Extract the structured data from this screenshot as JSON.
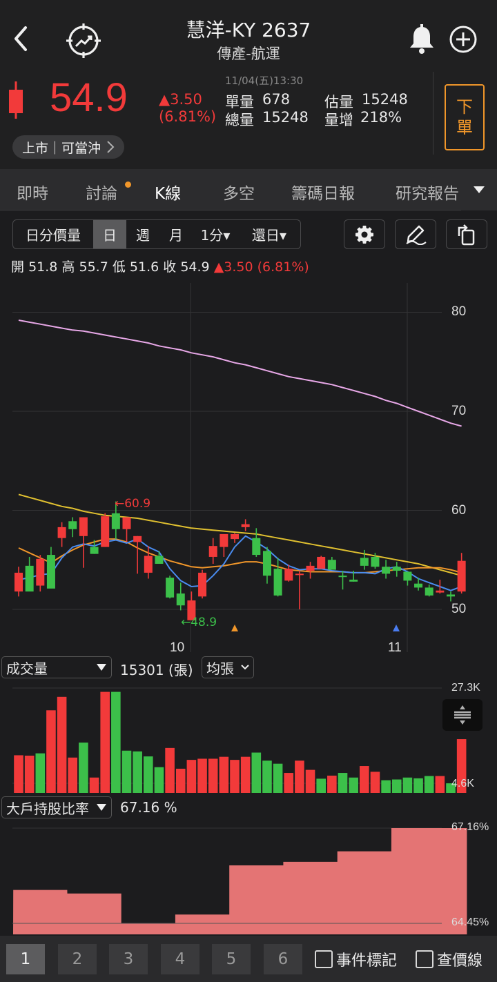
{
  "header": {
    "title": "慧洋-KY 2637",
    "subtitle": "傳產-航運",
    "datetime": "11/04(五)13:30",
    "price": "54.9",
    "change": "▲3.50",
    "change_pct": "(6.81%)",
    "unit_vol_label": "單量",
    "unit_vol": "678",
    "est_vol_label": "估量",
    "est_vol": "15248",
    "total_vol_label": "總量",
    "total_vol": "15248",
    "vol_inc_label": "量增",
    "vol_inc": "218%",
    "market_pill": "上市｜可當沖",
    "order_button": [
      "下",
      "單"
    ]
  },
  "tabs": [
    "即時",
    "討論",
    "K線",
    "多空",
    "籌碼日報",
    "研究報告"
  ],
  "toolbar": {
    "items": [
      "日分價量",
      "日",
      "週",
      "月",
      "1分▾",
      "還日▾"
    ],
    "selected": "日"
  },
  "ohlc": {
    "open_label": "開",
    "open": "51.8",
    "high_label": "高",
    "high": "55.7",
    "low_label": "低",
    "low": "51.6",
    "close_label": "收",
    "close": "54.9",
    "change": "▲3.50 (6.81%)"
  },
  "price_chart": {
    "y_ticks": [
      "80",
      "70",
      "60",
      "50"
    ],
    "x_ticks": [
      "10",
      "11"
    ],
    "high_marker": "←60.9",
    "low_marker": "←48.9"
  },
  "volume_panel": {
    "selector": "成交量",
    "value": "15301 (張)",
    "avg_selector": "均張",
    "y_max": "27.3K",
    "y_min": "4.6K"
  },
  "holder_panel": {
    "selector": "大戶持股比率",
    "value": "67.16 %",
    "y_max": "67.16%",
    "y_min": "64.45%"
  },
  "bottom": {
    "pages": [
      "1",
      "2",
      "3",
      "4",
      "5",
      "6"
    ],
    "selected_page": "1",
    "event_mark": "事件標記",
    "price_line": "查價線"
  },
  "colors": {
    "up": "#f23a3a",
    "down": "#3cc04a",
    "accent": "#f0962a",
    "ma_blue": "#4a8cf0",
    "ma_orange": "#f0962a",
    "ma_yellow": "#e0c030",
    "ma_pink": "#e8a8e8"
  },
  "chart_data": [
    {
      "type": "candlestick",
      "title": "",
      "ylim": [
        47,
        82
      ],
      "y_ticks": [
        50,
        60,
        70,
        80
      ],
      "x_ticks": [
        "10",
        "11"
      ],
      "candles": [
        [
          51.8,
          54.3,
          51.3,
          53.7
        ],
        [
          54.4,
          55.3,
          52.8,
          51.8
        ],
        [
          52.4,
          55.5,
          51.8,
          55.1
        ],
        [
          55.5,
          56.3,
          53.1,
          52.1
        ],
        [
          57.2,
          58.8,
          56.3,
          58.3
        ],
        [
          58.9,
          59.3,
          57.3,
          58.1
        ],
        [
          57.4,
          59.3,
          54.2,
          59.3
        ],
        [
          56.3,
          57.0,
          55.6,
          55.6
        ],
        [
          56.3,
          59.7,
          56.3,
          59.4
        ],
        [
          59.7,
          60.9,
          57.1,
          58.1
        ],
        [
          58.1,
          58.9,
          56.8,
          59.3
        ],
        [
          56.8,
          57.4,
          53.6,
          57.4
        ],
        [
          53.7,
          56.4,
          53.1,
          55.4
        ],
        [
          55.4,
          55.9,
          54.6,
          54.6
        ],
        [
          53.2,
          53.4,
          51.1,
          51.2
        ],
        [
          51.6,
          52.7,
          49.9,
          50.4
        ],
        [
          48.9,
          51.8,
          48.9,
          50.9
        ],
        [
          51.3,
          54.0,
          51.1,
          53.7
        ],
        [
          55.3,
          57.2,
          54.6,
          56.4
        ],
        [
          56.3,
          57.5,
          55.3,
          57.6
        ],
        [
          57.1,
          57.7,
          56.7,
          57.6
        ],
        [
          58.3,
          59.1,
          57.9,
          58.6
        ],
        [
          57.2,
          58.2,
          55.3,
          55.5
        ],
        [
          55.9,
          56.3,
          52.6,
          53.4
        ],
        [
          54.1,
          55.2,
          51.3,
          51.4
        ],
        [
          52.9,
          54.5,
          52.8,
          54.1
        ],
        [
          53.6,
          53.9,
          50.0,
          53.6
        ],
        [
          53.9,
          54.8,
          53.1,
          54.4
        ],
        [
          54.1,
          55.4,
          54.1,
          55.3
        ],
        [
          55.0,
          55.3,
          54.3,
          54.0
        ],
        [
          53.4,
          53.9,
          52.0,
          53.3
        ],
        [
          53.0,
          53.9,
          52.8,
          52.8
        ],
        [
          55.2,
          56.0,
          54.0,
          54.4
        ],
        [
          55.3,
          55.7,
          54.1,
          54.3
        ],
        [
          54.3,
          55.0,
          53.1,
          53.6
        ],
        [
          54.3,
          54.8,
          53.3,
          53.9
        ],
        [
          53.8,
          53.8,
          52.4,
          52.9
        ],
        [
          52.6,
          53.2,
          51.9,
          52.2
        ],
        [
          52.2,
          52.5,
          51.3,
          51.4
        ],
        [
          51.7,
          53.0,
          51.6,
          51.9
        ],
        [
          51.5,
          51.8,
          50.8,
          51.3
        ],
        [
          51.8,
          55.7,
          51.6,
          54.9
        ]
      ],
      "ma": {
        "blue": [
          53.0,
          53.2,
          53.5,
          53.6,
          55.2,
          56.3,
          56.6,
          56.4,
          56.8,
          57.0,
          56.7,
          57.1,
          56.3,
          55.8,
          54.1,
          52.9,
          52.3,
          52.4,
          53.4,
          54.6,
          56.3,
          57.4,
          56.8,
          56.1,
          55.1,
          54.4,
          54.0,
          54.1,
          54.1,
          53.9,
          53.8,
          53.7,
          53.7,
          53.6,
          54.1,
          54.3,
          53.8,
          53.1,
          52.7,
          52.3,
          51.9,
          52.3
        ],
        "orange": [
          56.2,
          55.7,
          55.2,
          54.7,
          55.4,
          56.0,
          56.5,
          56.8,
          57.1,
          57.1,
          56.8,
          56.2,
          55.7,
          55.3,
          54.9,
          54.6,
          54.3,
          54.2,
          54.3,
          54.4,
          54.6,
          54.8,
          54.8,
          54.6,
          54.3,
          54.0,
          53.9,
          53.8,
          53.8,
          53.8,
          53.8,
          53.7,
          53.7,
          53.8,
          53.9,
          54.0,
          54.1,
          54.2,
          54.2,
          54.2,
          54.0,
          53.7
        ],
        "yellow": [
          61.6,
          61.3,
          61.0,
          60.7,
          60.4,
          60.2,
          59.9,
          59.7,
          59.5,
          59.4,
          59.3,
          59.2,
          59.0,
          58.8,
          58.6,
          58.4,
          58.2,
          58.1,
          58.0,
          57.9,
          57.8,
          57.7,
          57.6,
          57.4,
          57.2,
          57.0,
          56.8,
          56.6,
          56.4,
          56.2,
          56.0,
          55.8,
          55.6,
          55.4,
          55.2,
          55.0,
          54.8,
          54.6,
          54.3,
          54.0,
          53.7,
          53.4
        ],
        "pink": [
          79.2,
          79.0,
          78.8,
          78.6,
          78.4,
          78.2,
          78.1,
          77.9,
          77.7,
          77.5,
          77.3,
          77.1,
          76.9,
          76.6,
          76.4,
          76.2,
          75.9,
          75.7,
          75.5,
          75.2,
          74.9,
          74.7,
          74.4,
          74.1,
          73.8,
          73.5,
          73.3,
          73.1,
          72.9,
          72.7,
          72.4,
          72.1,
          71.8,
          71.5,
          71.1,
          70.8,
          70.4,
          70.0,
          69.6,
          69.2,
          68.8,
          68.5
        ]
      },
      "annotations": [
        "←60.9",
        "←48.9"
      ]
    },
    {
      "type": "bar",
      "title": "成交量",
      "ylim": [
        0,
        27300
      ],
      "y_ticks": [
        "27.3K",
        "4.6K"
      ],
      "values": [
        9800,
        9700,
        10300,
        21500,
        25000,
        9200,
        13100,
        4000,
        26300,
        26300,
        11000,
        10800,
        9500,
        6700,
        11700,
        6300,
        8600,
        8900,
        8900,
        9400,
        8600,
        9400,
        10500,
        8400,
        7600,
        5200,
        8400,
        6000,
        3700,
        4500,
        5200,
        4000,
        7000,
        5500,
        3300,
        3500,
        4000,
        3800,
        4400,
        4400,
        2500,
        14000
      ],
      "up": [
        true,
        true,
        false,
        true,
        true,
        true,
        false,
        true,
        true,
        false,
        false,
        false,
        false,
        false,
        true,
        true,
        true,
        true,
        true,
        true,
        true,
        true,
        false,
        false,
        false,
        true,
        true,
        true,
        false,
        true,
        false,
        false,
        true,
        true,
        false,
        false,
        false,
        false,
        false,
        true,
        false,
        true
      ]
    },
    {
      "type": "area",
      "title": "大戶持股比率",
      "ylim": [
        64.4,
        67.16
      ],
      "y_ticks": [
        "67.16%",
        "64.45%"
      ],
      "values": [
        65.4,
        65.4,
        65.4,
        65.4,
        65.4,
        65.3,
        65.3,
        65.3,
        65.3,
        65.3,
        64.45,
        64.45,
        64.45,
        64.45,
        64.45,
        64.7,
        64.7,
        64.7,
        64.7,
        64.7,
        66.1,
        66.1,
        66.1,
        66.1,
        66.1,
        66.2,
        66.2,
        66.2,
        66.2,
        66.2,
        66.5,
        66.5,
        66.5,
        66.5,
        66.5,
        67.16,
        67.16,
        67.16,
        67.16,
        67.16,
        67.16,
        67.16
      ]
    }
  ]
}
